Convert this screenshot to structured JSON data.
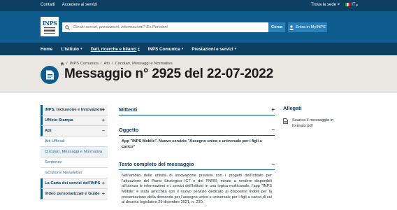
{
  "topbar": {
    "links": [
      "Contatti",
      "Accedere ai servizi"
    ],
    "find_office": "Trova la sede",
    "language": "IT"
  },
  "header": {
    "logo_text": "INPS",
    "search_placeholder": "Cerchi servizi, prestazioni, informazioni? Es.Pensioni",
    "search_button": "Cerca",
    "mynps_button": "Entra in MyINPS"
  },
  "nav": {
    "items": [
      {
        "label": "Home"
      },
      {
        "label": "L'istituto"
      },
      {
        "label": "Dati, ricerche e bilanci"
      },
      {
        "label": "INPS Comunica"
      },
      {
        "label": "Prestazioni e servizi"
      }
    ]
  },
  "breadcrumb": [
    "INPS Comunica",
    "Atti",
    "Circolari, Messaggi e Normativa"
  ],
  "page_title": "Messaggio n° 2925 del 22-07-2022",
  "sidebar": {
    "items": [
      {
        "label": "INPS, Inclusione e Innovazione",
        "toggle": "+"
      },
      {
        "label": "Ufficio Stampa",
        "toggle": "+"
      },
      {
        "label": "Atti",
        "toggle": "−"
      },
      {
        "label": "Atti Ufficiali"
      },
      {
        "label": "Circolari, Messaggi e Normativa"
      },
      {
        "label": "Sentenze"
      },
      {
        "label": "Iscrizione Newsletter"
      },
      {
        "label": "La Carta dei servizi dell'INPS",
        "toggle": "+"
      },
      {
        "label": "Video personalizzati e Guide",
        "toggle": "+"
      }
    ]
  },
  "main": {
    "mittenti": {
      "title": "Mittenti",
      "toggle": "+"
    },
    "oggetto": {
      "title": "Oggetto",
      "toggle": "−",
      "text": "App \"INPS Mobile\". Nuovo servizio \"Assegno unico e universale per i figli a carico\""
    },
    "testo": {
      "title": "Testo completo del messaggio",
      "toggle": "−",
      "text": "Nell'ambito delle attività di innovazione previste con i progetti dell'Istituto per l'attuazione del Piano Strategico ICT e del PNRR, mirate a rendere disponibili all'utenza le informazioni e i servizi dell'Istituto in una logica multicanale, l'app \"INPS Mobile\" è stata arricchita con il nuovo servizio dedicato ai dispositivi mobili per la presentazione della domanda per l'assegno unico e universale per i figli a carico,di cui al decreto legislativo 29 dicembre 2021, n. 230."
    }
  },
  "allegati": {
    "title": "Allegati",
    "items": [
      {
        "label": "Scarica il messaggio in formato pdf"
      }
    ]
  },
  "colors": {
    "brand_dark": "#0c3f61",
    "brand": "#0f5d8f",
    "accent": "#2a7fb8",
    "band": "#eae7e2"
  }
}
